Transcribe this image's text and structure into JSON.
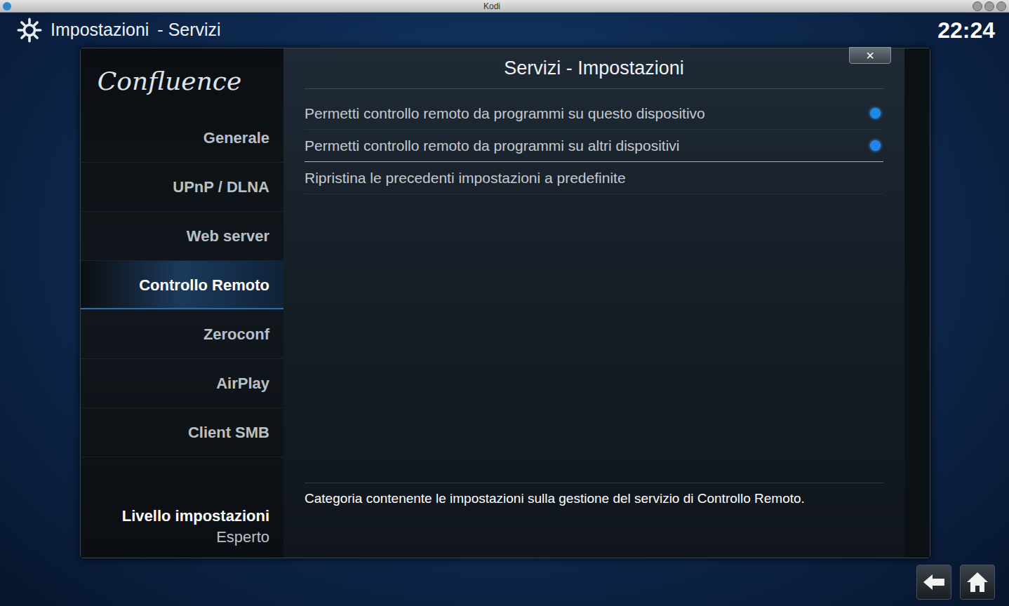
{
  "window": {
    "title": "Kodi"
  },
  "header": {
    "title": "Impostazioni",
    "section": "- Servizi",
    "time": "22:24"
  },
  "sidebar": {
    "logo": "Confluence",
    "items": [
      {
        "label": "Generale",
        "selected": false
      },
      {
        "label": "UPnP / DLNA",
        "selected": false
      },
      {
        "label": "Web server",
        "selected": false
      },
      {
        "label": "Controllo Remoto",
        "selected": true
      },
      {
        "label": "Zeroconf",
        "selected": false
      },
      {
        "label": "AirPlay",
        "selected": false
      },
      {
        "label": "Client SMB",
        "selected": false
      }
    ],
    "level": {
      "label": "Livello impostazioni",
      "value": "Esperto"
    }
  },
  "panel": {
    "title": "Servizi - Impostazioni",
    "close": "×",
    "settings": [
      {
        "label": "Permetti controllo remoto da programmi su questo dispositivo",
        "kind": "toggle",
        "on": true
      },
      {
        "label": "Permetti controllo remoto da programmi su altri dispositivi",
        "kind": "toggle",
        "on": true
      },
      {
        "label": "Ripristina le precedenti impostazioni a predefinite",
        "kind": "action"
      }
    ],
    "description": "Categoria contenente le impostazioni sulla gestione del servizio di Controllo Remoto."
  }
}
